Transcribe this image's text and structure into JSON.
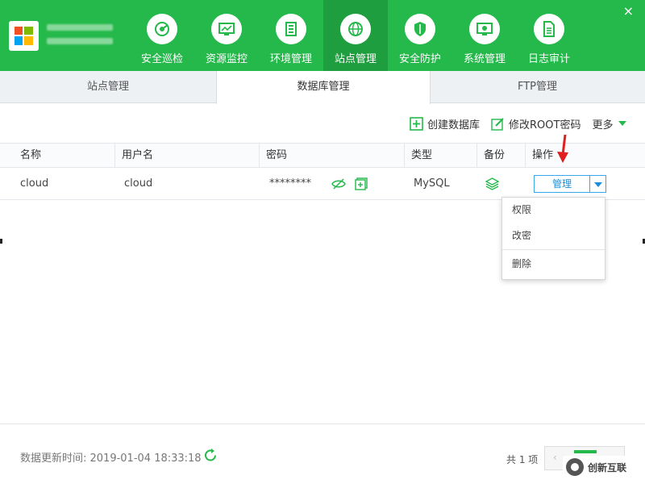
{
  "header": {
    "nav": [
      {
        "label": "安全巡检",
        "icon": "radar-icon"
      },
      {
        "label": "资源监控",
        "icon": "monitor-chart-icon"
      },
      {
        "label": "环境管理",
        "icon": "server-stack-icon"
      },
      {
        "label": "站点管理",
        "icon": "globe-icon",
        "active": true
      },
      {
        "label": "安全防护",
        "icon": "shield-icon"
      },
      {
        "label": "系统管理",
        "icon": "monitor-settings-icon"
      },
      {
        "label": "日志审计",
        "icon": "document-icon"
      }
    ],
    "close": "×",
    "accent": "#25b84a"
  },
  "tabs": [
    {
      "label": "站点管理"
    },
    {
      "label": "数据库管理",
      "active": true
    },
    {
      "label": "FTP管理"
    }
  ],
  "toolbar": {
    "create_db": "创建数据库",
    "change_root_pwd": "修改ROOT密码",
    "more": "更多"
  },
  "table": {
    "headers": [
      "名称",
      "用户名",
      "密码",
      "类型",
      "备份",
      "操作"
    ],
    "rows": [
      {
        "name": "cloud",
        "username": "cloud",
        "password": "********",
        "type": "MySQL",
        "action": "管理"
      }
    ]
  },
  "dropdown": {
    "items": [
      "权限",
      "改密",
      "删除"
    ]
  },
  "footer": {
    "update_time": "数据更新时间: 2019-01-04 18:33:18",
    "total": "共 1 项",
    "prev": "‹"
  },
  "watermark": {
    "text": "创新互联"
  }
}
